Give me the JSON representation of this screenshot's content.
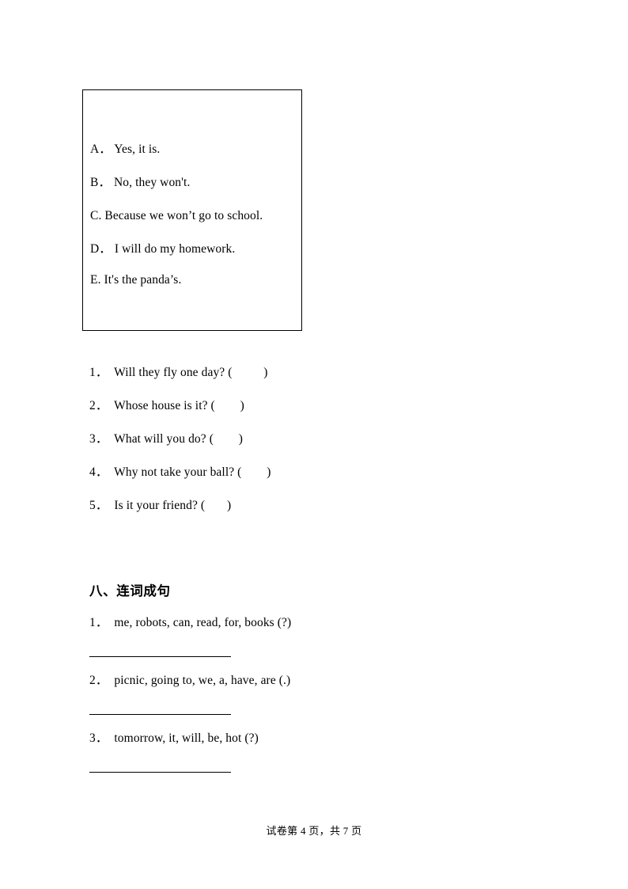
{
  "document": {
    "type": "exam-paper",
    "page_background": "#ffffff",
    "text_color": "#000000"
  },
  "options_box": {
    "name": "answer-options-box",
    "options": [
      {
        "label": "A．",
        "text": "Yes, it is."
      },
      {
        "label": "B．",
        "text": "No, they won't."
      },
      {
        "label": "C.",
        "text": "Because we won’t go to school."
      },
      {
        "label": "D．",
        "text": "I will do my homework."
      },
      {
        "label": "E.",
        "text": "It's the panda’s."
      }
    ],
    "lines": [
      "A．  Yes, it is.",
      "B．  No, they won't.",
      "C. Because we won’t go to school.",
      "D．  I will do my homework.",
      "E. It's the panda’s."
    ]
  },
  "matching_questions": {
    "items": [
      {
        "number": "1．",
        "text": "Will they fly one day? (",
        "close": ")",
        "full": "1．  Will they fly one day? (          )"
      },
      {
        "number": "2．",
        "text": "Whose house is it? (",
        "close": ")",
        "full": "2．  Whose house is it? (        )"
      },
      {
        "number": "3．",
        "text": "What will you do? (",
        "close": ")",
        "full": "3．  What will you do? (        )"
      },
      {
        "number": "4．",
        "text": "Why not take your ball? (",
        "close": ")",
        "full": "4．  Why not take your ball? (        )"
      },
      {
        "number": "5．",
        "text": "Is it your friend? (",
        "close": ")",
        "full": "5．  Is it your friend? (       )"
      }
    ]
  },
  "section_eight": {
    "heading": "八、连词成句",
    "items": [
      {
        "number": "1．",
        "words": "me, robots, can, read, for, books (?)",
        "full": "1．  me, robots, can, read, for, books (?)"
      },
      {
        "number": "2．",
        "words": "picnic, going to, we, a, have, are (.)",
        "full": "2．  picnic, going to, we, a, have, are (.)"
      },
      {
        "number": "3．",
        "words": "tomorrow, it, will, be, hot (?)",
        "full": "3．  tomorrow, it, will, be, hot (?)"
      }
    ],
    "answer_line_count": 3
  },
  "footer": {
    "prefix": "试卷第",
    "current_page": "4",
    "middle": "页，共",
    "total_pages": "7",
    "suffix": "页",
    "full": "试卷第 4 页，共 7 页"
  }
}
